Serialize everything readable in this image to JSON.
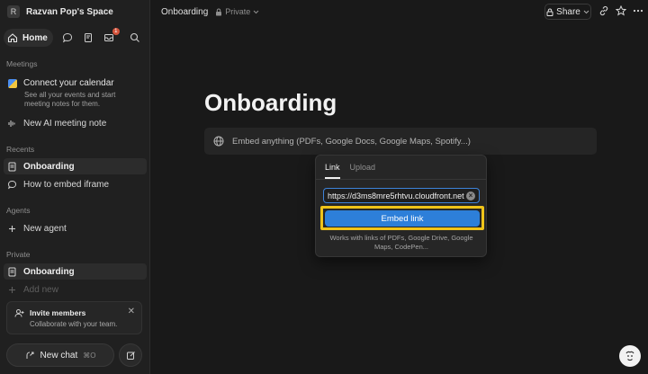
{
  "workspace": {
    "initial": "R",
    "name": "Razvan Pop's Space"
  },
  "nav": {
    "home_label": "Home",
    "inbox_badge": "1"
  },
  "meetings": {
    "title": "Meetings",
    "calendar_title": "Connect your calendar",
    "calendar_sub": "See all your events and start meeting notes for them.",
    "ai_note": "New AI meeting note"
  },
  "recents": {
    "title": "Recents",
    "items": [
      "Onboarding",
      "How to embed iframe"
    ]
  },
  "agents": {
    "title": "Agents",
    "new_agent": "New agent"
  },
  "private": {
    "title": "Private",
    "items": [
      "Onboarding",
      "Add new"
    ]
  },
  "invite": {
    "title": "Invite members",
    "sub": "Collaborate with your team."
  },
  "new_chat": {
    "label": "New chat",
    "shortcut": "⌘O"
  },
  "topbar": {
    "page": "Onboarding",
    "privacy": "Private",
    "share": "Share"
  },
  "page": {
    "title": "Onboarding",
    "embed_placeholder": "Embed anything (PDFs, Google Docs, Google Maps, Spotify...)"
  },
  "popover": {
    "tabs": [
      "Link",
      "Upload"
    ],
    "url_value": "https://d3ms8mre5rhtvu.cloudfront.net",
    "button": "Embed link",
    "hint": "Works with links of PDFs, Google Drive, Google Maps, CodePen..."
  },
  "colors": {
    "accent": "#2d7fd9",
    "highlight": "#f0c419",
    "badge": "#d4533b"
  }
}
